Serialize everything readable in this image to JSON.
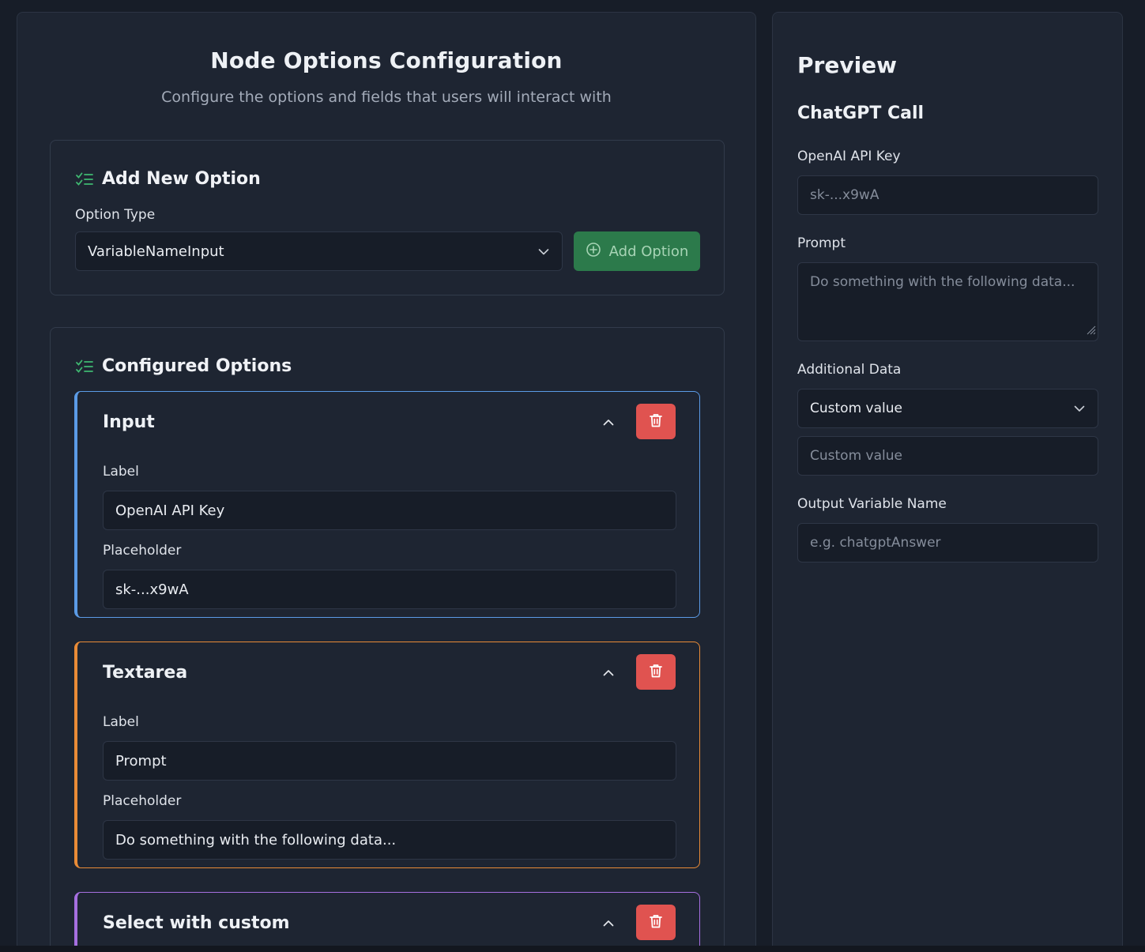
{
  "config": {
    "title": "Node Options Configuration",
    "subtitle": "Configure the options and fields that users will interact with",
    "add_section": {
      "heading": "Add New Option",
      "option_type_label": "Option Type",
      "option_type_value": "VariableNameInput",
      "add_button_label": "Add Option"
    },
    "configured_section": {
      "heading": "Configured Options",
      "options": [
        {
          "type": "Input",
          "label_field_label": "Label",
          "label_value": "OpenAI API Key",
          "placeholder_field_label": "Placeholder",
          "placeholder_value": "sk-...x9wA"
        },
        {
          "type": "Textarea",
          "label_field_label": "Label",
          "label_value": "Prompt",
          "placeholder_field_label": "Placeholder",
          "placeholder_value": "Do something with the following data..."
        },
        {
          "type": "Select with custom"
        }
      ]
    }
  },
  "preview": {
    "title": "Preview",
    "node_title": "ChatGPT Call",
    "fields": {
      "api_key_label": "OpenAI API Key",
      "api_key_placeholder": "sk-...x9wA",
      "prompt_label": "Prompt",
      "prompt_placeholder": "Do something with the following data...",
      "additional_data_label": "Additional Data",
      "additional_data_selected": "Custom value",
      "additional_data_custom_placeholder": "Custom value",
      "output_variable_label": "Output Variable Name",
      "output_variable_placeholder": "e.g. chatgptAnswer"
    }
  },
  "colors": {
    "background": "#171d28",
    "panel": "#1e2532",
    "add_button": "#2c7a4b",
    "delete_button": "#e05350",
    "input_accent": "#5b9be6",
    "textarea_accent": "#e98b37",
    "select_accent": "#a66fe0",
    "checklist_icon": "#3fb871"
  },
  "icons": {
    "section_icon": "checklist-icon",
    "add_icon": "plus-circle-icon",
    "delete_icon": "trash-icon",
    "collapse_icon": "chevron-up-icon",
    "dropdown_icon": "chevron-down-icon"
  }
}
